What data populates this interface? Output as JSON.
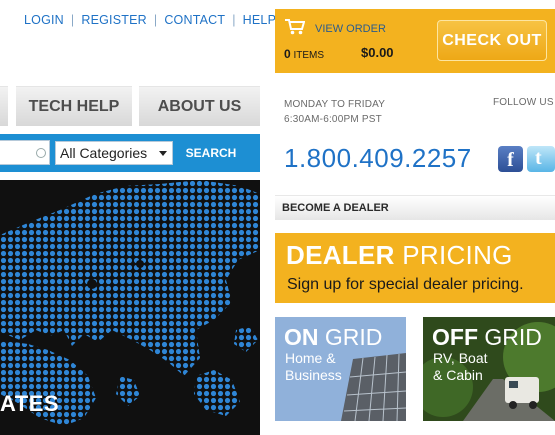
{
  "top_links": [
    "LOGIN",
    "REGISTER",
    "CONTACT",
    "HELP"
  ],
  "cart": {
    "view_order": "VIEW ORDER",
    "item_count": "0",
    "items_label": "ITEMS",
    "total": "$0.00",
    "checkout_label": "CHECK OUT",
    "accent_color": "#f3b21f"
  },
  "nav": {
    "tabs": [
      "TECH HELP",
      "ABOUT US"
    ]
  },
  "search": {
    "placeholder": "",
    "category_selected": "All Categories",
    "button_label": "SEARCH"
  },
  "hero": {
    "caption": "ATES"
  },
  "contact": {
    "hours_line1": "MONDAY TO FRIDAY",
    "hours_line2": "6:30AM-6:00PM PST",
    "follow_label": "FOLLOW US",
    "phone": "1.800.409.2257"
  },
  "dealer": {
    "bar_label": "BECOME A DEALER",
    "promo_bold": "DEALER",
    "promo_light": " PRICING",
    "promo_sub": "Sign up for special dealer pricing."
  },
  "tiles": {
    "on_grid": {
      "bold": "ON",
      "light": " GRID",
      "line1": "Home &",
      "line2": "Business"
    },
    "off_grid": {
      "bold": "OFF",
      "light": " GRID",
      "line1": "RV, Boat",
      "line2": "& Cabin"
    }
  },
  "icons": [
    "cart-icon",
    "search-icon",
    "dropdown-arrow-icon",
    "facebook-icon",
    "twitter-icon"
  ]
}
